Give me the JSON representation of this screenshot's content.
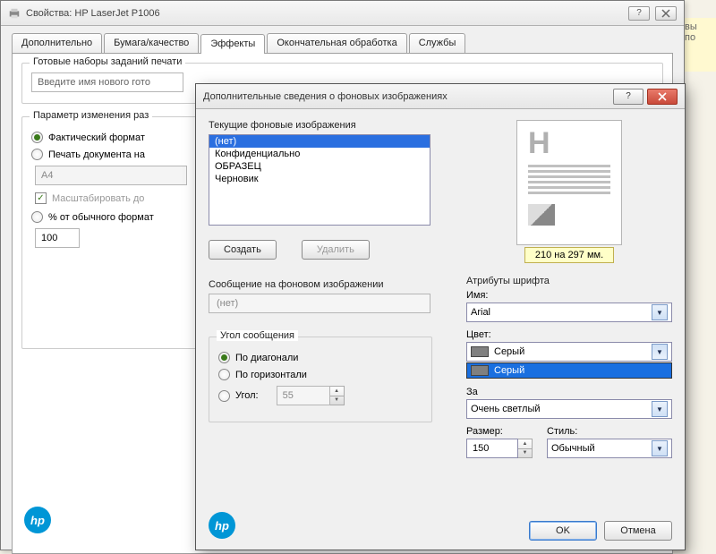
{
  "main_window": {
    "title": "Свойства: HP LaserJet P1006",
    "tabs": [
      "Дополнительно",
      "Бумага/качество",
      "Эффекты",
      "Окончательная обработка",
      "Службы"
    ],
    "active_tab_index": 2,
    "presets_group": "Готовые наборы заданий печати",
    "presets_placeholder": "Введите имя нового гото",
    "resize_group": "Параметр изменения раз",
    "radio_actual": "Фактический формат",
    "radio_print_on": "Печать документа на",
    "paper_size": "A4",
    "scale_checkbox": "Масштабировать до",
    "radio_percent": "% от обычного формат",
    "percent_value": "100"
  },
  "modal": {
    "title": "Дополнительные сведения о фоновых изображениях",
    "current_bg_label": "Текущие фоновые изображения",
    "list_items": [
      "(нет)",
      "Конфиденциально",
      "ОБРАЗЕЦ",
      "Черновик"
    ],
    "selected_index": 0,
    "create_btn": "Создать",
    "delete_btn": "Удалить",
    "message_label": "Сообщение на фоновом изображении",
    "message_value": "(нет)",
    "angle_group": "Угол сообщения",
    "angle_diag": "По диагонали",
    "angle_horiz": "По горизонтали",
    "angle_custom": "Угол:",
    "angle_value": "55",
    "angle_selected": 0,
    "preview_caption": "210 на 297 мм.",
    "font_attrs": "Атрибуты шрифта",
    "name_label": "Имя:",
    "name_value": "Arial",
    "color_label": "Цвет:",
    "color_value": "Серый",
    "color_option_hi": "Серый",
    "shade_value": "Очень светлый",
    "shade_label_partial": "За",
    "size_label": "Размер:",
    "size_value": "150",
    "style_label": "Стиль:",
    "style_value": "Обычный",
    "ok": "OK",
    "cancel": "Отмена"
  },
  "side_text": {
    "l1": "вы",
    "l2": "по"
  }
}
